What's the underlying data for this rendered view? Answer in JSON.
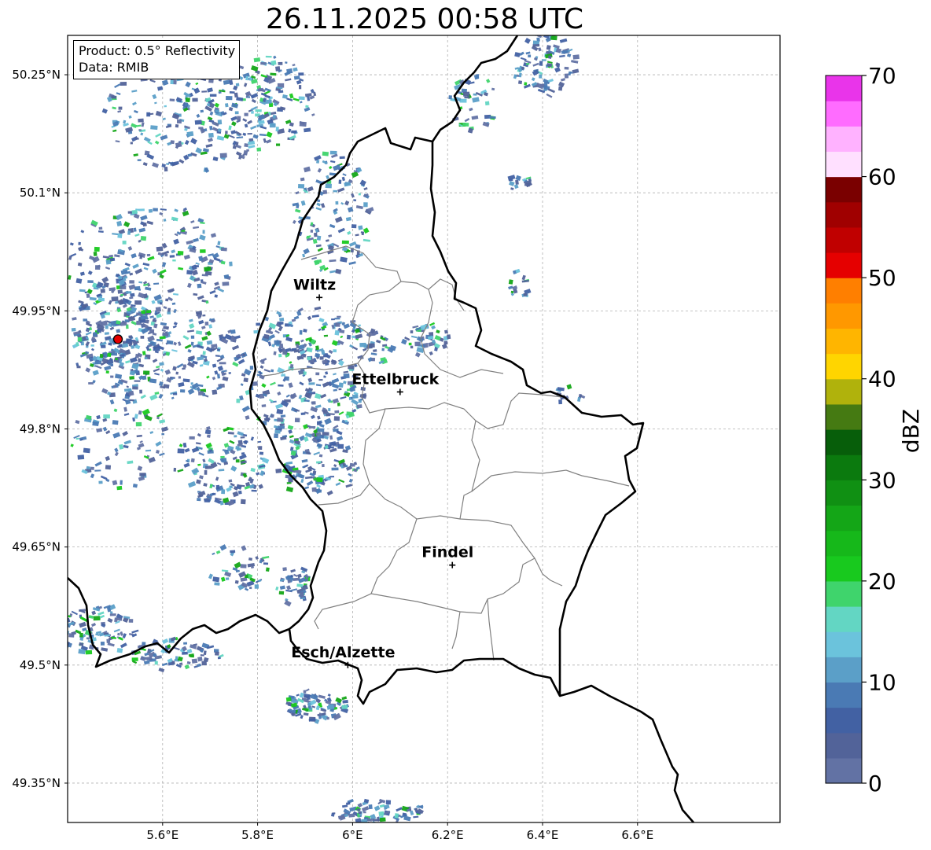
{
  "title": "26.11.2025 00:58 UTC",
  "info": {
    "product": "Product: 0.5° Reflectivity",
    "data": "Data: RMIB"
  },
  "map": {
    "lon_range": [
      5.4,
      6.9
    ],
    "lat_range": [
      49.3,
      50.3
    ],
    "lon_ticks": [
      {
        "value": 5.6,
        "label": "5.6°E"
      },
      {
        "value": 5.8,
        "label": "5.8°E"
      },
      {
        "value": 6.0,
        "label": "6°E"
      },
      {
        "value": 6.2,
        "label": "6.2°E"
      },
      {
        "value": 6.4,
        "label": "6.4°E"
      },
      {
        "value": 6.6,
        "label": "6.6°E"
      }
    ],
    "lat_ticks": [
      {
        "value": 50.25,
        "label": "50.25°N"
      },
      {
        "value": 50.1,
        "label": "50.1°N"
      },
      {
        "value": 49.95,
        "label": "49.95°N"
      },
      {
        "value": 49.8,
        "label": "49.8°N"
      },
      {
        "value": 49.65,
        "label": "49.65°N"
      },
      {
        "value": 49.5,
        "label": "49.5°N"
      },
      {
        "value": 49.35,
        "label": "49.35°N"
      }
    ],
    "grid": true,
    "cities": [
      {
        "name": "Wiltz",
        "lon": 5.93,
        "lat": 49.967
      },
      {
        "name": "Ettelbruck",
        "lon": 6.1,
        "lat": 49.847
      },
      {
        "name": "Findel",
        "lon": 6.21,
        "lat": 49.627
      },
      {
        "name": "Esch/Alzette",
        "lon": 5.99,
        "lat": 49.5
      }
    ],
    "radar_site": {
      "lon": 5.506,
      "lat": 49.914
    },
    "border_color": "#000000",
    "canton_color": "#808080"
  },
  "colorbar": {
    "label": "dBZ",
    "min": 0,
    "max": 70,
    "ticks": [
      "0",
      "10",
      "20",
      "30",
      "40",
      "50",
      "60",
      "70"
    ],
    "colors": [
      "#6272a4",
      "#526399",
      "#4261a3",
      "#4a7ab4",
      "#5b9fc8",
      "#6bc3dc",
      "#63d6c3",
      "#3fd46c",
      "#18c91e",
      "#16b81a",
      "#14a617",
      "#109013",
      "#0b7a0e",
      "#075e0a",
      "#457a12",
      "#b0b20c",
      "#ffd500",
      "#ffb500",
      "#ff9800",
      "#ff7f00",
      "#e50000",
      "#c00000",
      "#a00000",
      "#7a0000",
      "#ffe0ff",
      "#ffb2ff",
      "#ff6cff",
      "#e934ea"
    ]
  }
}
